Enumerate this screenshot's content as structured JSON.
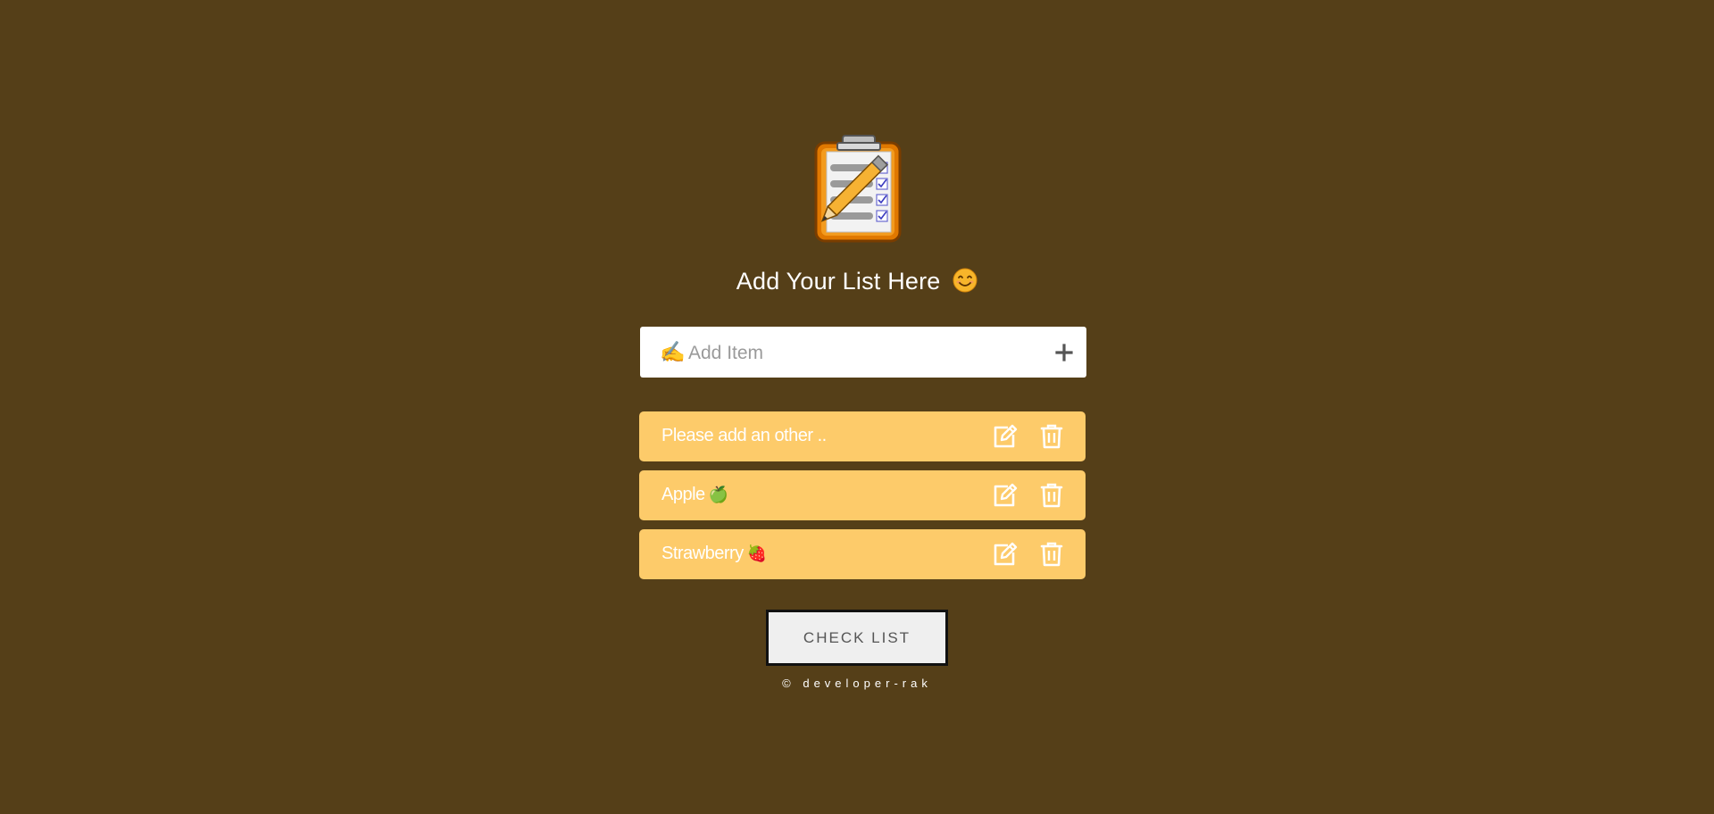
{
  "header": {
    "title": "Add Your List Here",
    "title_emoji_icon": "smiling-face-icon",
    "logo_icon": "clipboard-checklist-pencil-icon"
  },
  "input": {
    "prefix_emoji": "✍️",
    "placeholder": "Add Item",
    "value": "",
    "add_icon": "plus-icon"
  },
  "items": [
    {
      "label": "Please add an other ..",
      "emoji": ""
    },
    {
      "label": "Apple",
      "emoji": "🍏"
    },
    {
      "label": "Strawberry",
      "emoji": "🍓"
    }
  ],
  "actions": {
    "edit_icon": "edit-icon",
    "delete_icon": "trash-icon"
  },
  "check_button": {
    "label": "CHECK LIST"
  },
  "footer": {
    "text": "© developer-rak"
  },
  "colors": {
    "background": "#553f18",
    "item_background": "#fdcb6a",
    "input_background": "#ffffff",
    "button_background": "#efefef"
  }
}
